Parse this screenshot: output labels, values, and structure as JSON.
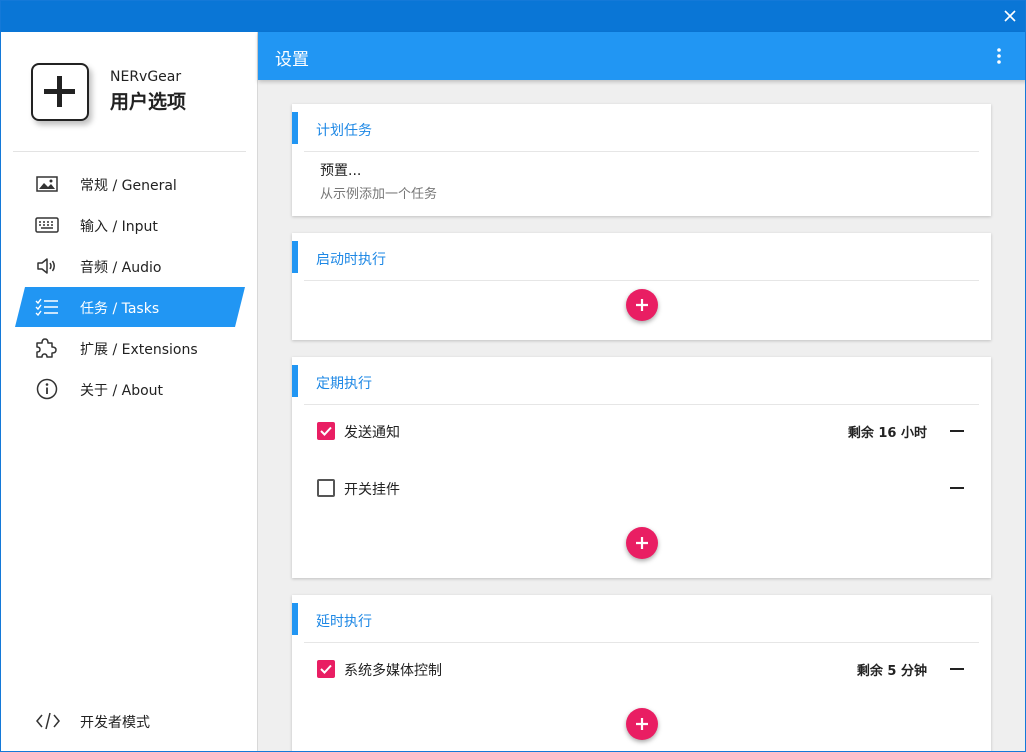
{
  "window": {
    "close_glyph": "×"
  },
  "sidebar": {
    "app_name": "NERvGear",
    "app_subtitle": "用户选项",
    "items": [
      {
        "label": "常规 / General",
        "icon": "image-icon"
      },
      {
        "label": "输入 / Input",
        "icon": "keyboard-icon"
      },
      {
        "label": "音频 / Audio",
        "icon": "speaker-icon"
      },
      {
        "label": "任务 / Tasks",
        "icon": "checklist-icon",
        "active": true
      },
      {
        "label": "扩展 / Extensions",
        "icon": "puzzle-icon"
      },
      {
        "label": "关于 / About",
        "icon": "info-icon"
      }
    ],
    "dev_mode_label": "开发者模式"
  },
  "app_bar": {
    "title": "设置"
  },
  "sections": {
    "scheduled": {
      "title": "计划任务",
      "preset_title": "预置...",
      "preset_subtitle": "从示例添加一个任务"
    },
    "startup": {
      "title": "启动时执行"
    },
    "periodic": {
      "title": "定期执行",
      "tasks": [
        {
          "label": "发送通知",
          "checked": true,
          "remaining": "剩余 16 小时"
        },
        {
          "label": "开关挂件",
          "checked": false,
          "remaining": ""
        }
      ]
    },
    "delayed": {
      "title": "延时执行",
      "tasks": [
        {
          "label": "系统多媒体控制",
          "checked": true,
          "remaining": "剩余 5 分钟"
        }
      ]
    }
  },
  "colors": {
    "accent": "#2196f3",
    "titlebar": "#0a76d6",
    "fab": "#e91e63"
  }
}
